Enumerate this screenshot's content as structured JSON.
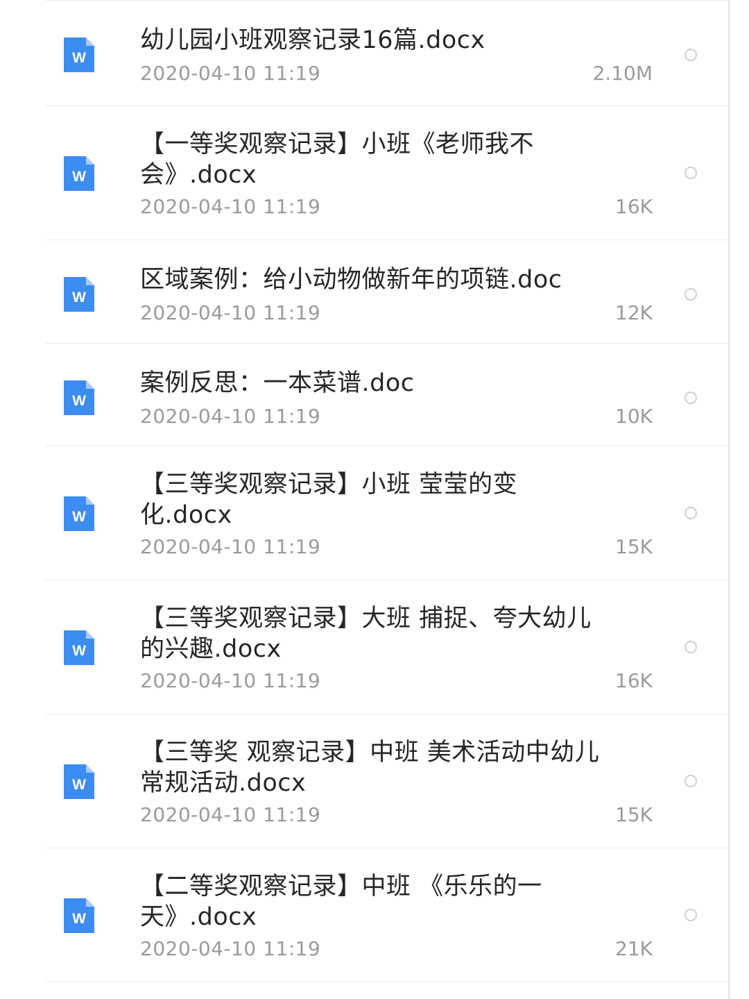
{
  "colors": {
    "icon_blue": "#3c8cf2",
    "title_text": "#262626",
    "meta_text": "#9a9a9a",
    "divider": "#ececec"
  },
  "files": [
    {
      "name": "幼儿园小班观察记录16篇.docx",
      "date": "2020-04-10 11:19",
      "size": "2.10M",
      "icon": "word-doc-icon",
      "icon_letter": "W"
    },
    {
      "name": "【一等奖观察记录】小班《老师我不会》.docx",
      "date": "2020-04-10 11:19",
      "size": "16K",
      "icon": "word-doc-icon",
      "icon_letter": "W"
    },
    {
      "name": "区域案例：给小动物做新年的项链.doc",
      "date": "2020-04-10 11:19",
      "size": "12K",
      "icon": "word-doc-icon",
      "icon_letter": "W"
    },
    {
      "name": "案例反思：一本菜谱.doc",
      "date": "2020-04-10 11:19",
      "size": "10K",
      "icon": "word-doc-icon",
      "icon_letter": "W"
    },
    {
      "name": "【三等奖观察记录】小班 莹莹的变化.docx",
      "date": "2020-04-10 11:19",
      "size": "15K",
      "icon": "word-doc-icon",
      "icon_letter": "W"
    },
    {
      "name": "【三等奖观察记录】大班 捕捉、夸大幼儿的兴趣.docx",
      "date": "2020-04-10 11:19",
      "size": "16K",
      "icon": "word-doc-icon",
      "icon_letter": "W"
    },
    {
      "name": "【三等奖 观察记录】中班 美术活动中幼儿常规活动.docx",
      "date": "2020-04-10 11:19",
      "size": "15K",
      "icon": "word-doc-icon",
      "icon_letter": "W"
    },
    {
      "name": "【二等奖观察记录】中班 《乐乐的一天》.docx",
      "date": "2020-04-10 11:19",
      "size": "21K",
      "icon": "word-doc-icon",
      "icon_letter": "W"
    }
  ]
}
